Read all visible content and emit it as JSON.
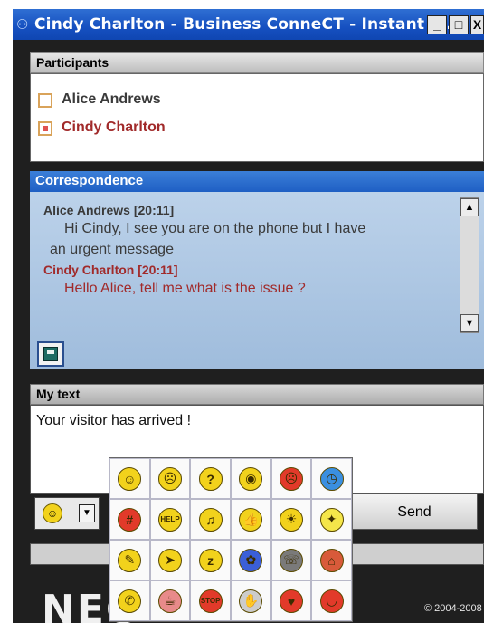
{
  "window": {
    "title": "Cindy Charlton - Business ConneCT - Instant m...",
    "minimize": "_",
    "maximize": "□",
    "close": "X"
  },
  "participants": {
    "header": "Participants",
    "items": [
      {
        "name": "Alice Andrews",
        "active": false
      },
      {
        "name": "Cindy Charlton",
        "active": true
      }
    ]
  },
  "correspondence": {
    "header": "Correspondence",
    "messages": [
      {
        "author": "Alice Andrews [20:11]",
        "lines": [
          "Hi Cindy, I see you are on the phone but I have",
          "an urgent message"
        ]
      },
      {
        "author": "Cindy Charlton [20:11]",
        "lines": [
          "Hello Alice, tell me what is the issue ?"
        ]
      }
    ],
    "scroll_up": "▲",
    "scroll_down": "▼"
  },
  "my_text": {
    "header": "My text",
    "value": "Your visitor has arrived !"
  },
  "send_label": "Send",
  "smiley_drop": "▼",
  "brand": "NEC",
  "copyright": "© 2004-2008",
  "colors": {
    "title_bar": "#1f5fc4",
    "correspondence_header": "#2a6bd0",
    "alice_color": "#3a3a3a",
    "cindy_color": "#a12a2a"
  },
  "emoticons": [
    {
      "name": "smile",
      "glyph": "☺",
      "color": "#f2d21c"
    },
    {
      "name": "sad",
      "glyph": "☹",
      "color": "#f2d21c"
    },
    {
      "name": "confused",
      "glyph": "?",
      "color": "#f2d21c"
    },
    {
      "name": "eyes",
      "glyph": "◉",
      "color": "#f2d21c"
    },
    {
      "name": "angry-red",
      "glyph": "☹",
      "color": "#e23a2a"
    },
    {
      "name": "clock",
      "glyph": "◷",
      "color": "#3a8fe0"
    },
    {
      "name": "swearing",
      "glyph": "#",
      "color": "#e23a2a"
    },
    {
      "name": "help",
      "glyph": "HELP",
      "color": "#f2d21c"
    },
    {
      "name": "headphones",
      "glyph": "♫",
      "color": "#f2d21c"
    },
    {
      "name": "thumbs-up",
      "glyph": "👍",
      "color": "#f2d21c"
    },
    {
      "name": "beach",
      "glyph": "☀",
      "color": "#f2d21c"
    },
    {
      "name": "lightbulb",
      "glyph": "✦",
      "color": "#f5e64a"
    },
    {
      "name": "writing",
      "glyph": "✎",
      "color": "#f2d21c"
    },
    {
      "name": "party-horn",
      "glyph": "➤",
      "color": "#f2d21c"
    },
    {
      "name": "sleeping",
      "glyph": "z",
      "color": "#f2d21c"
    },
    {
      "name": "flower",
      "glyph": "✿",
      "color": "#3b5fd8"
    },
    {
      "name": "phone-face",
      "glyph": "☏",
      "color": "#7a7a7a"
    },
    {
      "name": "house",
      "glyph": "⌂",
      "color": "#d85a3a"
    },
    {
      "name": "telephone",
      "glyph": "✆",
      "color": "#f2d21c"
    },
    {
      "name": "coffee-cup",
      "glyph": "☕",
      "color": "#e88a8a"
    },
    {
      "name": "stop-sign",
      "glyph": "STOP",
      "color": "#e23a2a"
    },
    {
      "name": "handshake",
      "glyph": "✋",
      "color": "#cccccc"
    },
    {
      "name": "heart",
      "glyph": "♥",
      "color": "#e23a2a"
    },
    {
      "name": "lips",
      "glyph": "◡",
      "color": "#e23a2a"
    }
  ]
}
